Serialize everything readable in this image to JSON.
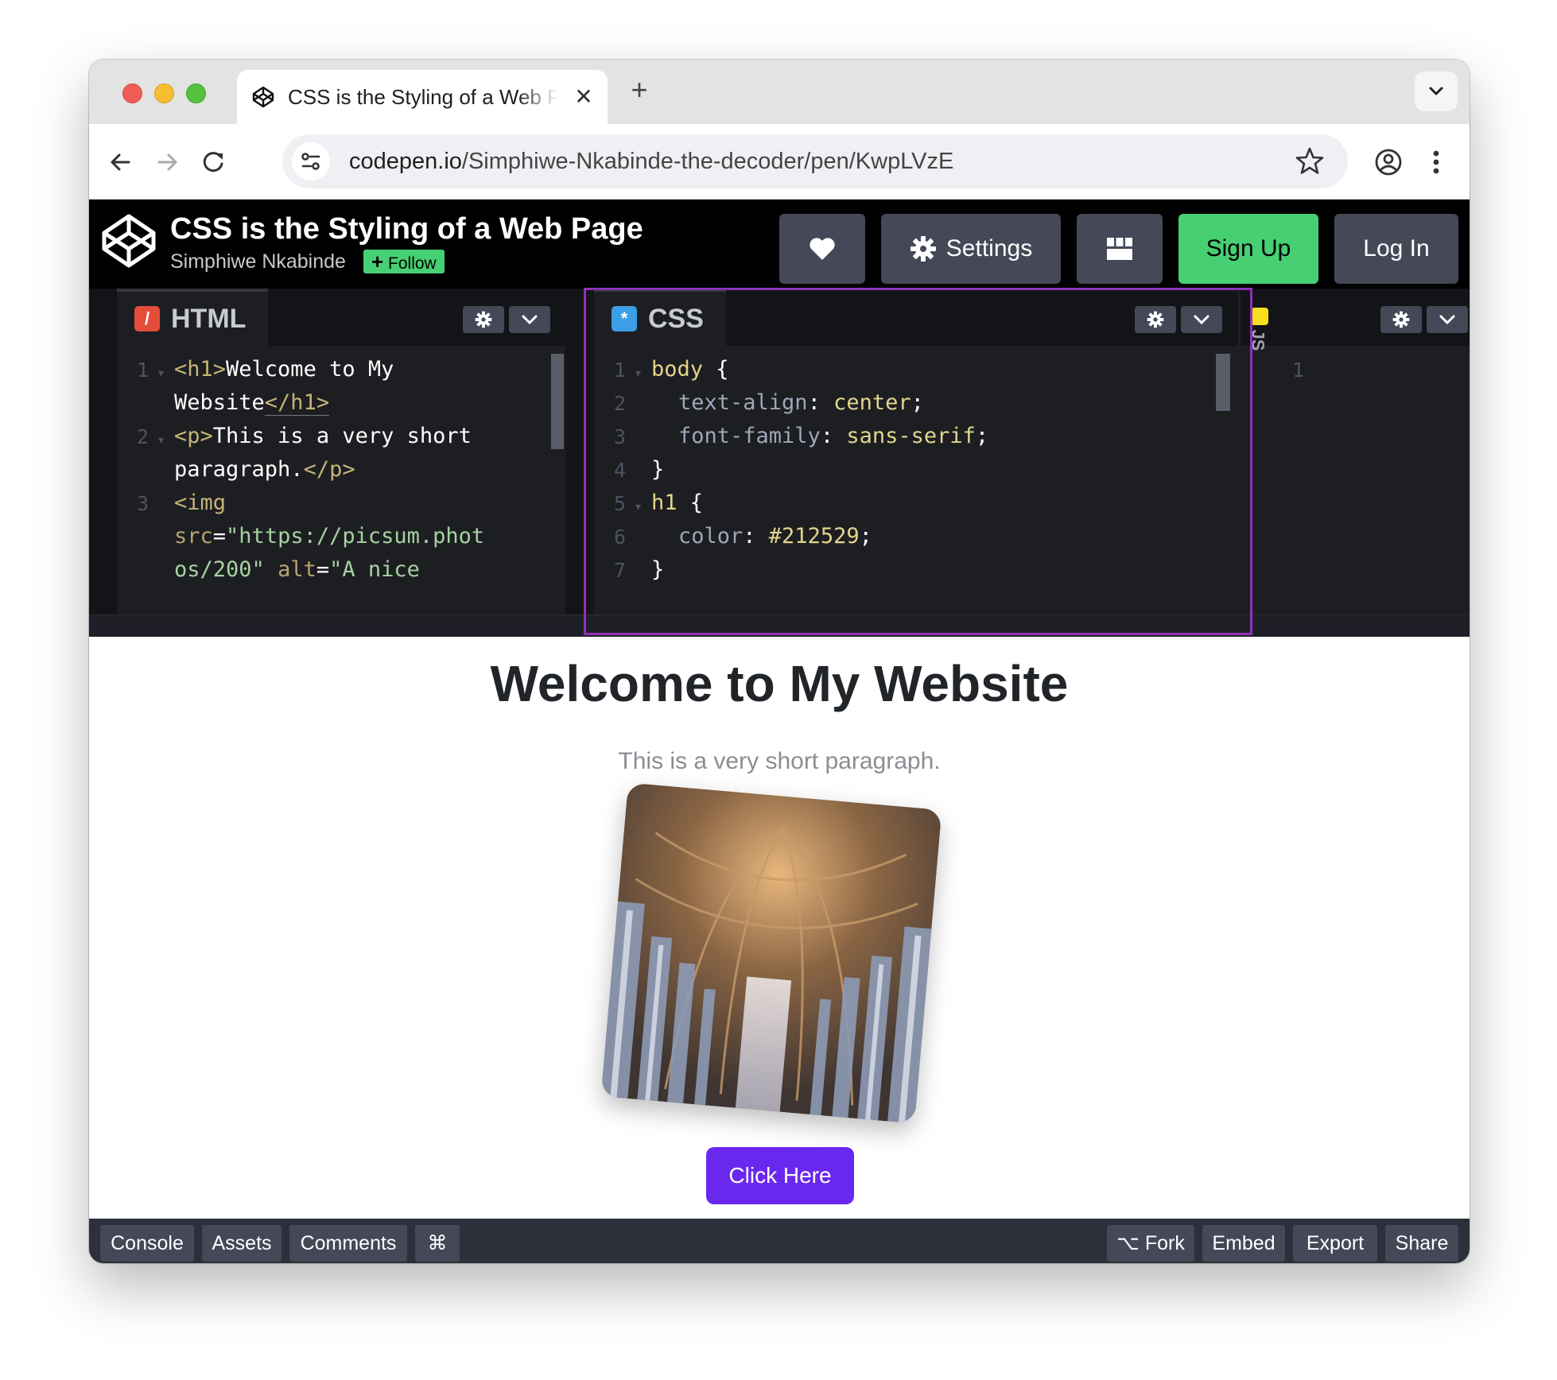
{
  "browser": {
    "tab_title": "CSS is the Styling of a Web Page",
    "tab_close": "✕",
    "new_tab": "+",
    "url_host": "codepen.io",
    "url_path": "/Simphiwe-Nkabinde-the-decoder/pen/KwpLVzE"
  },
  "header": {
    "pen_title": "CSS is the Styling of a Web Page",
    "author": "Simphiwe Nkabinde",
    "follow_label": "Follow",
    "settings_label": "Settings",
    "signup_label": "Sign Up",
    "login_label": "Log In"
  },
  "editors": {
    "html": {
      "label": "HTML",
      "line_numbers": [
        "1",
        "2",
        "3"
      ],
      "lines": {
        "l1a_tag": "<h1>",
        "l1a_text": "Welcome to My",
        "l1b_text": "Website",
        "l1b_tag": "</h1>",
        "l2a_tag": "<p>",
        "l2a_text": "This is a very short",
        "l2b_text": "paragraph.",
        "l2b_tag": "</p>",
        "l3a_tag": "<img",
        "l3b_attr": "src",
        "l3b_eq": "=",
        "l3b_str": "\"https://picsum.phot",
        "l3c_str": "os/200\"",
        "l3c_attr": "alt",
        "l3c_eq": "=",
        "l3c_str2": "\"A nice"
      }
    },
    "css": {
      "label": "CSS",
      "line_numbers": [
        "1",
        "2",
        "3",
        "4",
        "5",
        "6",
        "7"
      ],
      "lines": {
        "l1_sel": "body",
        "l1_brace": " {",
        "l2_prop": "text-align",
        "l2_colon": ": ",
        "l2_val": "center",
        "l2_semi": ";",
        "l3_prop": "font-family",
        "l3_colon": ": ",
        "l3_val": "sans-serif",
        "l3_semi": ";",
        "l4": "}",
        "l5_sel": "h1",
        "l5_brace": " {",
        "l6_prop": "color",
        "l6_colon": ": ",
        "l6_val": "#212529",
        "l6_semi": ";",
        "l7": "}"
      }
    },
    "js": {
      "label": "JS",
      "line_numbers": [
        "1"
      ]
    }
  },
  "preview": {
    "heading": "Welcome to My Website",
    "paragraph": "This is a very short paragraph.",
    "image_alt": "A nice",
    "button_label": "Click Here"
  },
  "footer": {
    "left": [
      "Console",
      "Assets",
      "Comments",
      "⌘"
    ],
    "fork_label": "Fork",
    "right": [
      "Embed",
      "Export",
      "Share"
    ]
  },
  "colors": {
    "highlight_border": "#8e32b8",
    "signup_green": "#47cf73",
    "button_purple": "#6a28ee",
    "html_icon": "#e44d3a",
    "css_icon": "#3d9ee8",
    "js_icon": "#f7df1e"
  }
}
